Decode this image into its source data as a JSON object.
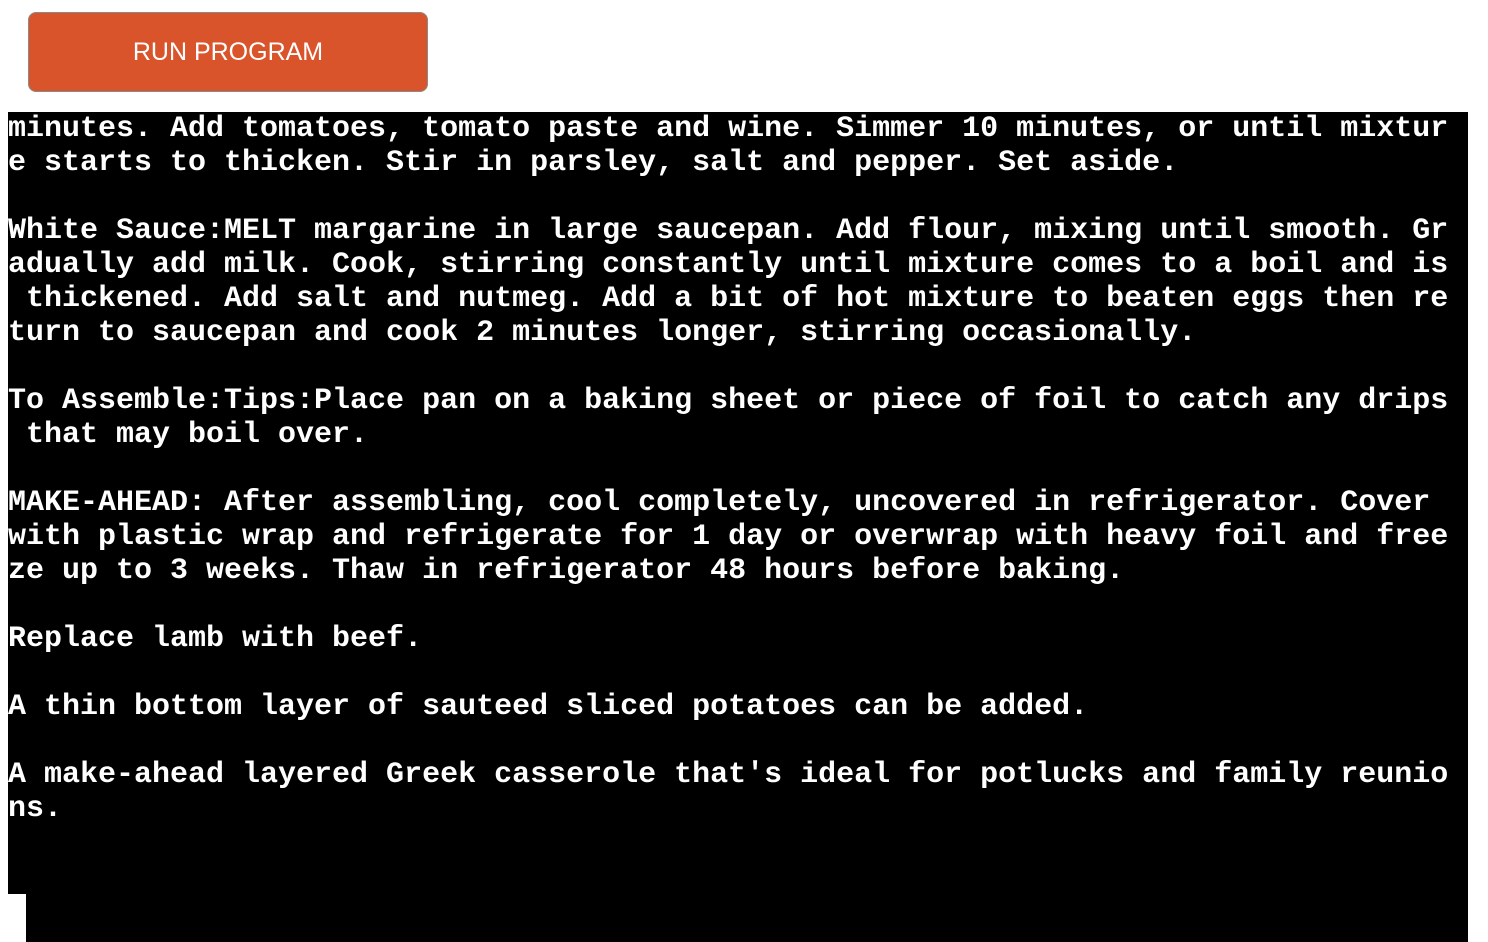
{
  "run_button": {
    "label": "RUN PROGRAM"
  },
  "terminal": {
    "lines": [
      "minutes. Add tomatoes, tomato paste and wine. Simmer 10 minutes, or until mixtur",
      "e starts to thicken. Stir in parsley, salt and pepper. Set aside.",
      "",
      "White Sauce:MELT margarine in large saucepan. Add flour, mixing until smooth. Gr",
      "adually add milk. Cook, stirring constantly until mixture comes to a boil and is",
      " thickened. Add salt and nutmeg. Add a bit of hot mixture to beaten eggs then re",
      "turn to saucepan and cook 2 minutes longer, stirring occasionally.",
      "",
      "To Assemble:Tips:Place pan on a baking sheet or piece of foil to catch any drips",
      " that may boil over.",
      "",
      "MAKE-AHEAD: After assembling, cool completely, uncovered in refrigerator. Cover ",
      "with plastic wrap and refrigerate for 1 day or overwrap with heavy foil and free",
      "ze up to 3 weeks. Thaw in refrigerator 48 hours before baking.",
      "",
      "Replace lamb with beef.",
      "",
      "A thin bottom layer of sauteed sliced potatoes can be added.",
      "",
      "A make-ahead layered Greek casserole that's ideal for potlucks and family reunio",
      "ns."
    ]
  }
}
